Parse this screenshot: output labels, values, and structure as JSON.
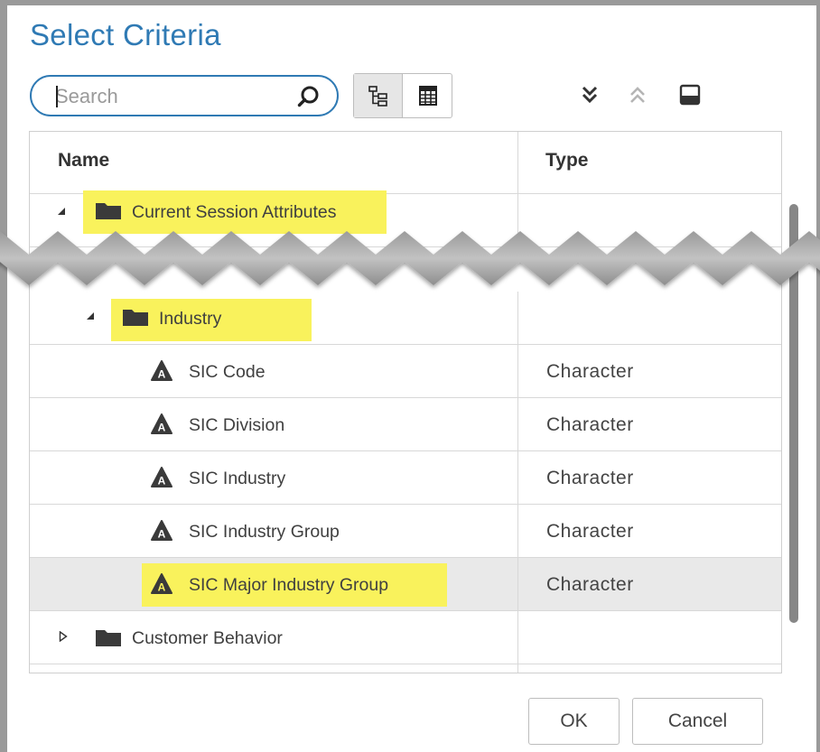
{
  "dialog": {
    "title": "Select Criteria"
  },
  "search": {
    "placeholder": "Search",
    "value": ""
  },
  "toolbar": {
    "tree_view_icon": "tree-view-icon",
    "table_view_icon": "table-view-icon",
    "expand_all_icon": "double-chevron-down-icon",
    "collapse_all_icon": "double-chevron-up-icon",
    "preview_icon": "window-panel-icon"
  },
  "table": {
    "columns": [
      "Name",
      "Type"
    ],
    "rows": [
      {
        "name": "Current Session Attributes",
        "type": "",
        "kind": "folder",
        "expanded": true,
        "highlighted": true
      },
      {
        "name": "Industry",
        "type": "",
        "kind": "folder",
        "expanded": true,
        "highlighted": true
      },
      {
        "name": "SIC Code",
        "type": "Character",
        "kind": "attribute"
      },
      {
        "name": "SIC Division",
        "type": "Character",
        "kind": "attribute"
      },
      {
        "name": "SIC Industry",
        "type": "Character",
        "kind": "attribute"
      },
      {
        "name": "SIC Industry Group",
        "type": "Character",
        "kind": "attribute"
      },
      {
        "name": "SIC Major Industry Group",
        "type": "Character",
        "kind": "attribute",
        "selected": true,
        "highlighted": true
      },
      {
        "name": "Customer Behavior",
        "type": "",
        "kind": "folder",
        "expanded": false
      }
    ]
  },
  "buttons": {
    "ok": "OK",
    "cancel": "Cancel"
  },
  "colors": {
    "accent": "#2f7ab4",
    "highlight": "#f9f25c",
    "selected_row": "#e9e9e9"
  }
}
